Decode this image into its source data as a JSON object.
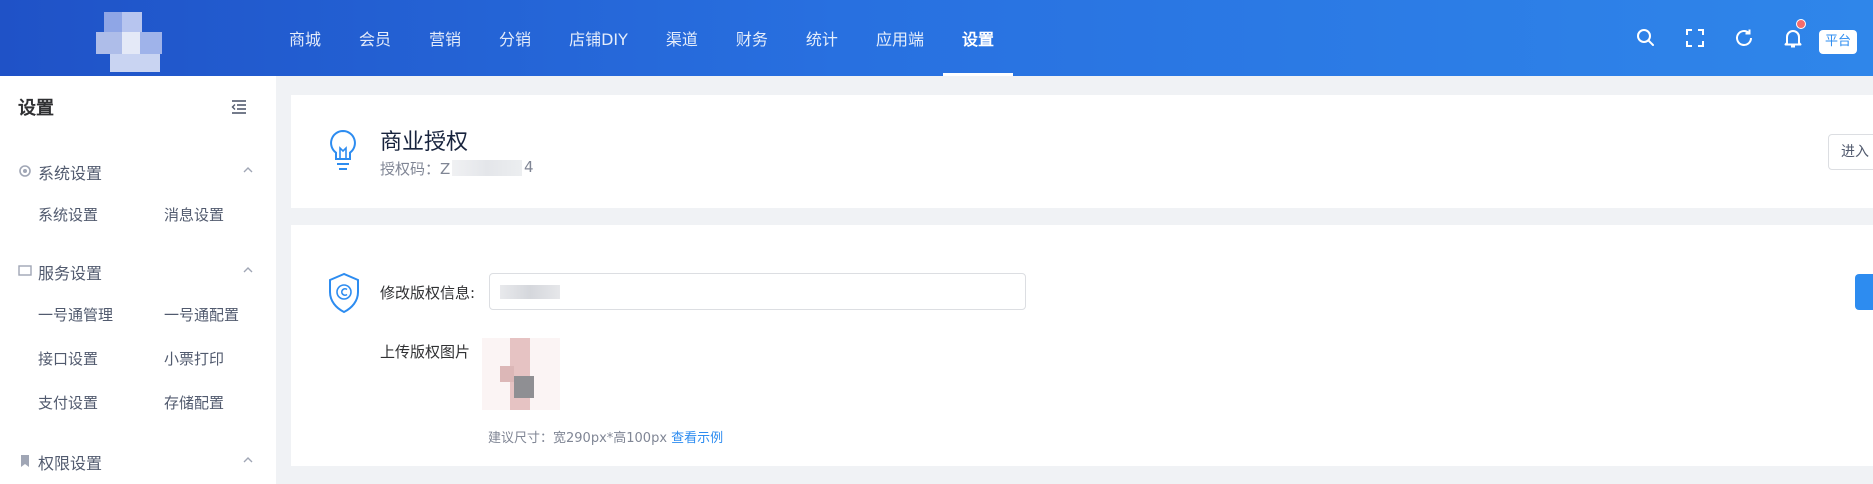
{
  "header": {
    "nav": [
      {
        "label": "商城"
      },
      {
        "label": "会员"
      },
      {
        "label": "营销"
      },
      {
        "label": "分销"
      },
      {
        "label": "店铺DIY"
      },
      {
        "label": "渠道"
      },
      {
        "label": "财务"
      },
      {
        "label": "统计"
      },
      {
        "label": "应用端"
      },
      {
        "label": "设置",
        "active": true
      }
    ],
    "tools": [
      "search-icon",
      "fullscreen-icon",
      "refresh-icon",
      "bell-icon"
    ],
    "platform_label": "平台",
    "colors": {
      "gradient_start": "#1f52c7",
      "gradient_end": "#2f86ea",
      "notification_dot": "#f56c6c"
    }
  },
  "sidebar": {
    "title": "设置",
    "groups": [
      {
        "label": "系统设置",
        "icon": "gear-icon",
        "items": [
          "系统设置",
          "消息设置"
        ]
      },
      {
        "label": "服务设置",
        "icon": "monitor-icon",
        "items": [
          "一号通管理",
          "一号通配置",
          "接口设置",
          "小票打印",
          "支付设置",
          "存储配置"
        ]
      },
      {
        "label": "权限设置",
        "icon": "bookmark-icon",
        "items": []
      }
    ]
  },
  "license": {
    "title": "商业授权",
    "code_label": "授权码：Z",
    "code_tail": "4",
    "enter_label": "进入"
  },
  "copyright": {
    "edit_label": "修改版权信息:",
    "upload_label": "上传版权图片",
    "hint": "建议尺寸：宽290px*高100px",
    "hint_link": "查看示例"
  },
  "colors": {
    "accent": "#2d8cf0",
    "background": "#f0f2f5"
  }
}
